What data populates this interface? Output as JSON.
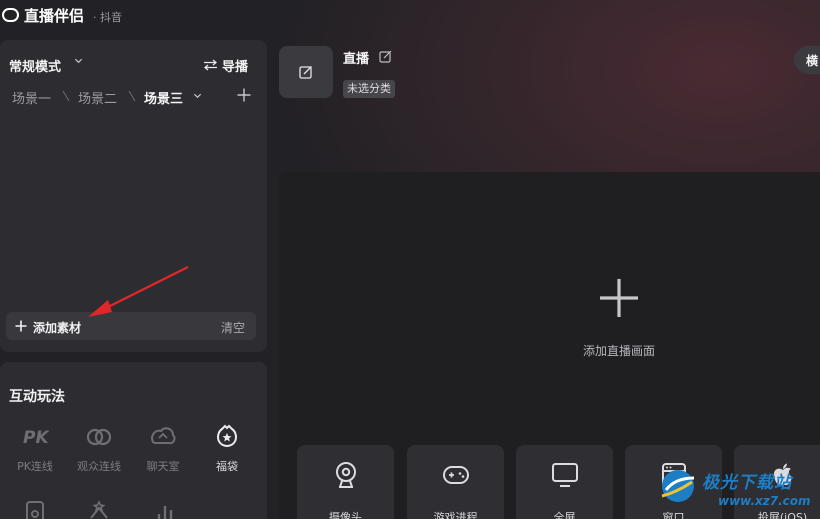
{
  "app": {
    "name": "直播伴侣",
    "platform": "· 抖音"
  },
  "left_panel": {
    "mode": "常规模式",
    "guide_label": "导播",
    "scenes": [
      "场景一",
      "场景二",
      "场景三"
    ],
    "active_scene": 2,
    "add_material_label": "添加素材",
    "clear_label": "清空"
  },
  "interactive": {
    "title": "互动玩法",
    "tools": [
      {
        "label": "PK连线",
        "icon": "pk-icon",
        "enabled": false
      },
      {
        "label": "观众连线",
        "icon": "link-icon",
        "enabled": false
      },
      {
        "label": "聊天室",
        "icon": "chat-room-icon",
        "enabled": false
      },
      {
        "label": "福袋",
        "icon": "lucky-bag-icon",
        "enabled": true
      }
    ]
  },
  "live_info": {
    "title": "直播",
    "category": "未选分类",
    "orientation_label": "横"
  },
  "canvas": {
    "add_label": "添加直播画面",
    "sources": [
      {
        "label": "摄像头",
        "icon": "camera-icon"
      },
      {
        "label": "游戏进程",
        "icon": "gamepad-icon"
      },
      {
        "label": "全屏",
        "icon": "monitor-icon"
      },
      {
        "label": "窗口",
        "icon": "window-icon"
      },
      {
        "label": "投屏(iOS)",
        "icon": "apple-icon"
      }
    ]
  },
  "watermark": {
    "name": "极光下载站",
    "url": "www.xz7.com"
  },
  "colors": {
    "accent_red": "#e0282a",
    "watermark_blue": "#1d7ec6"
  }
}
